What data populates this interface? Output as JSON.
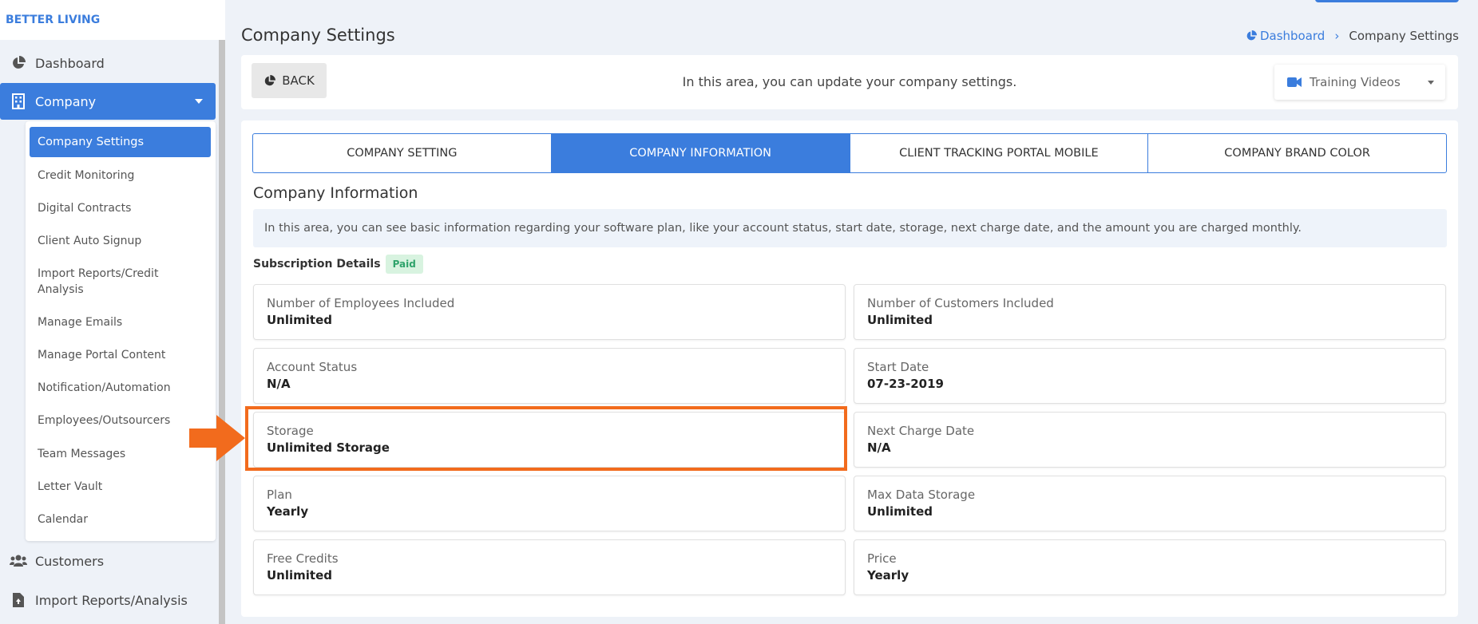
{
  "brand": "BETTER LIVING",
  "sidebar": {
    "dashboard": "Dashboard",
    "company": "Company",
    "customers": "Customers",
    "import_reports": "Import Reports/Analysis",
    "submenu": [
      "Company Settings",
      "Credit Monitoring",
      "Digital Contracts",
      "Client Auto Signup",
      "Import Reports/Credit Analysis",
      "Manage Emails",
      "Manage Portal Content",
      "Notification/Automation",
      "Employees/Outsourcers",
      "Team Messages",
      "Letter Vault",
      "Calendar"
    ]
  },
  "header": {
    "title": "Company Settings",
    "breadcrumb_home": "Dashboard",
    "breadcrumb_current": "Company Settings"
  },
  "bar": {
    "back_label": "BACK",
    "description": "In this area, you can update your company settings.",
    "training_label": "Training Videos"
  },
  "tabs": [
    "COMPANY SETTING",
    "COMPANY INFORMATION",
    "CLIENT TRACKING PORTAL MOBILE",
    "COMPANY BRAND COLOR"
  ],
  "active_tab": "COMPANY INFORMATION",
  "section": {
    "title": "Company Information",
    "info": "In this area, you can see basic information regarding your software plan, like your account status, start date, storage, next charge date, and the amount you are charged monthly.",
    "subscription_label": "Subscription Details",
    "subscription_status": "Paid"
  },
  "details": {
    "employees": {
      "label": "Number of Employees Included",
      "value": "Unlimited"
    },
    "customers": {
      "label": "Number of Customers Included",
      "value": "Unlimited"
    },
    "account_status": {
      "label": "Account Status",
      "value": "N/A"
    },
    "start_date": {
      "label": "Start Date",
      "value": "07-23-2019"
    },
    "storage": {
      "label": "Storage",
      "value": "Unlimited Storage"
    },
    "next_charge": {
      "label": "Next Charge Date",
      "value": "N/A"
    },
    "plan": {
      "label": "Plan",
      "value": "Yearly"
    },
    "max_storage": {
      "label": "Max Data Storage",
      "value": "Unlimited"
    },
    "free_credits": {
      "label": "Free Credits",
      "value": "Unlimited"
    },
    "price": {
      "label": "Price",
      "value": "Yearly"
    }
  },
  "colors": {
    "accent": "#3b7ddd",
    "highlight": "#f26b1d",
    "paid_badge": "#2fa36b"
  },
  "icons": {
    "dashboard": "pie-chart-icon",
    "company": "building-icon",
    "customers": "users-icon",
    "import": "file-upload-icon",
    "training": "video-camera-icon"
  }
}
